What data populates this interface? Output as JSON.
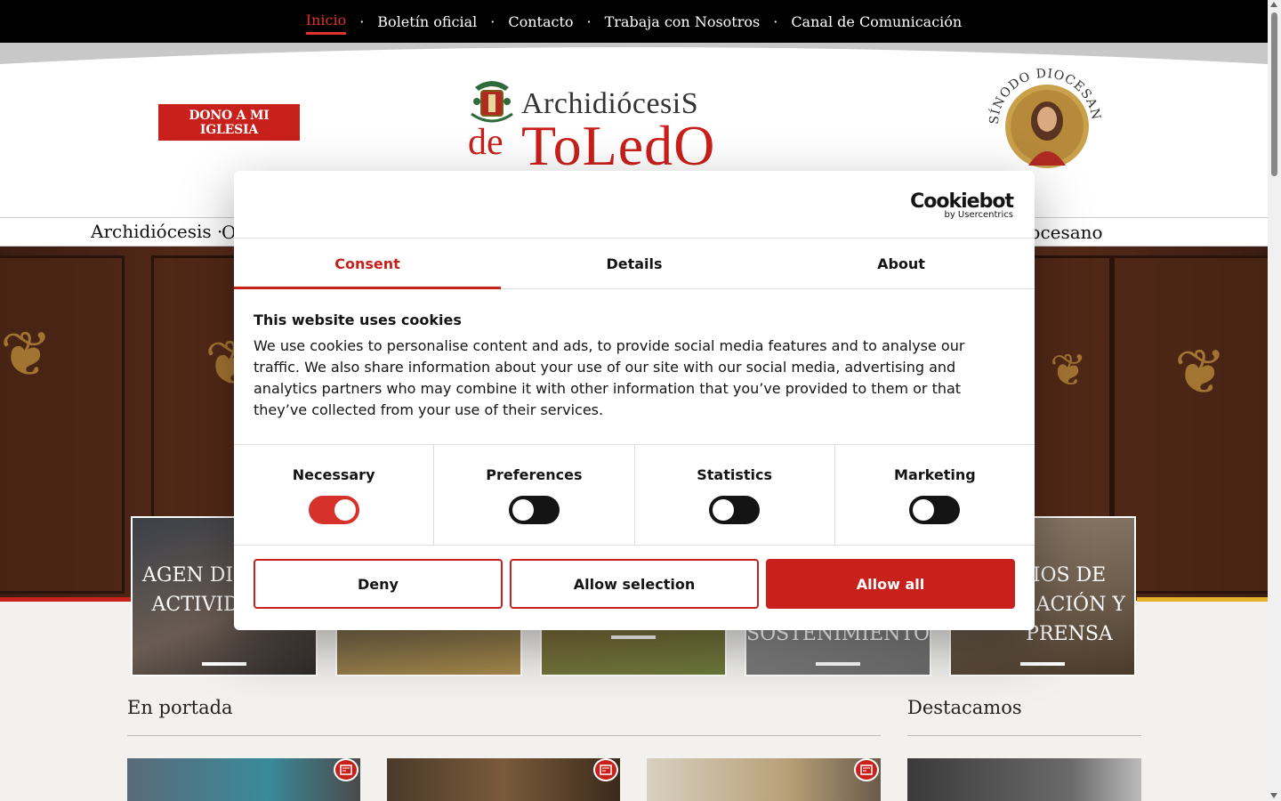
{
  "topnav": {
    "items": [
      {
        "label": "Inicio"
      },
      {
        "label": "Boletín oficial"
      },
      {
        "label": "Contacto"
      },
      {
        "label": "Trabaja con Nosotros"
      },
      {
        "label": "Canal de Comunicación"
      }
    ],
    "separator": "·"
  },
  "header": {
    "donate_label": "DONO A MI IGLESIA",
    "logo_line1": "ArchidiócesiS",
    "logo_de": "de",
    "logo_toledo": "ToLedO",
    "sinodo_text": "SÍNODO DIOCESANO"
  },
  "mainnav": {
    "first": "Archidiócesis ·",
    "second": "O",
    "last": "iocesano"
  },
  "cards": [
    {
      "label": "AGEN DIOCESA ACTIVIDADES"
    },
    {
      "label": ""
    },
    {
      "label": ""
    },
    {
      "label": "SOSTENIMIENTO"
    },
    {
      "label": "IOS DE ICACIÓN Y PRENSA"
    }
  ],
  "sections": {
    "portada": "En portada",
    "destacamos": "Destacamos"
  },
  "cookie": {
    "brand_name": "Cookiebot",
    "brand_by": "by Usercentrics",
    "tabs": [
      {
        "label": "Consent",
        "active": true
      },
      {
        "label": "Details",
        "active": false
      },
      {
        "label": "About",
        "active": false
      }
    ],
    "heading": "This website uses cookies",
    "text": "We use cookies to personalise content and ads, to provide social media features and to analyse our traffic. We also share information about your use of our site with our social media, advertising and analytics partners who may combine it with other information that you’ve provided to them or that they’ve collected from your use of their services.",
    "toggles": [
      {
        "label": "Necessary",
        "on": true
      },
      {
        "label": "Preferences",
        "on": false
      },
      {
        "label": "Statistics",
        "on": false
      },
      {
        "label": "Marketing",
        "on": false
      }
    ],
    "deny_label": "Deny",
    "selection_label": "Allow selection",
    "allow_all_label": "Allow all"
  },
  "colors": {
    "brand_red": "#c8201b",
    "accent_gold": "#e4b22a"
  }
}
